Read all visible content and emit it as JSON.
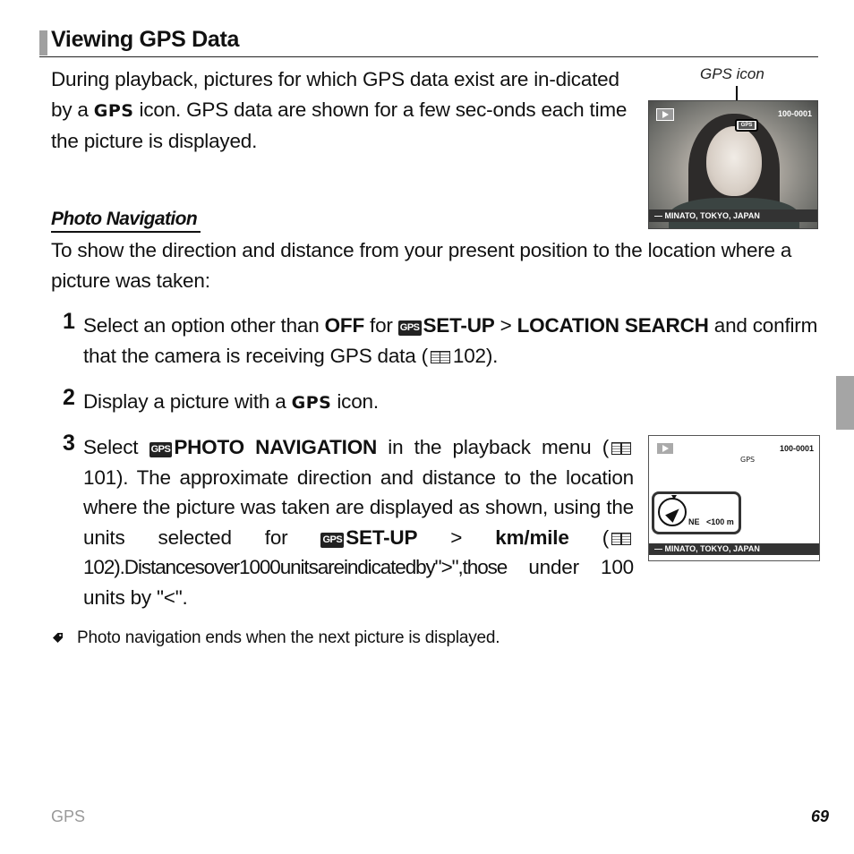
{
  "title": "Viewing GPS Data",
  "intro": {
    "part1": "During playback, pictures for which GPS data exist are in-dicated by a ",
    "gps_word": "GPS",
    "part2": " icon. GPS data are shown for a few sec-onds each time the picture is displayed."
  },
  "screen1": {
    "caption": "GPS icon",
    "play_icon": "playback-icon",
    "frame_number": "100-0001",
    "gps_label": "GPS",
    "location": "— MINATO, TOKYO, JAPAN"
  },
  "section": {
    "title": "Photo Navigation",
    "lead": "To show the direction and distance from your present position to the location where a picture was taken:"
  },
  "steps": [
    {
      "number": "1",
      "t1": "Select an option other than ",
      "b1": "OFF",
      "t2": " for ",
      "badge": "GPS",
      "b2": "SET-UP",
      "t3": " > ",
      "b3": "LOCATION SEARCH",
      "t4": " and confirm that the camera is receiving GPS data (",
      "page_ref": "102",
      "t5": ")."
    },
    {
      "number": "2",
      "t1": "Display a picture with a ",
      "gps_word": "GPS",
      "t2": " icon."
    },
    {
      "number": "3",
      "t1": "Select ",
      "badge": "GPS",
      "b1": "PHOTO NAVIGATION",
      "t2": " in the playback menu (",
      "page_ref1": "101",
      "t3": "). The approximate direction and distance to the location where the picture was taken are displayed as shown, using the units selected for ",
      "badge2": "GPS",
      "b2": "SET-UP",
      "t4": " > ",
      "b3": "km/mile",
      "t5": " (",
      "page_ref2": "102",
      "t6": ").Distancesover1000unitsareindicatedby\">\",those",
      "t7": " under 100 units by \"<\"."
    }
  ],
  "screen2": {
    "play_icon": "playback-icon",
    "frame_number": "100-0001",
    "gps_label": "GPS",
    "direction": "NE",
    "distance": "<100 m",
    "location": "— MINATO, TOKYO, JAPAN"
  },
  "note": "Photo navigation ends when the next picture is displayed.",
  "footer": {
    "section": "GPS",
    "page_number": "69"
  }
}
